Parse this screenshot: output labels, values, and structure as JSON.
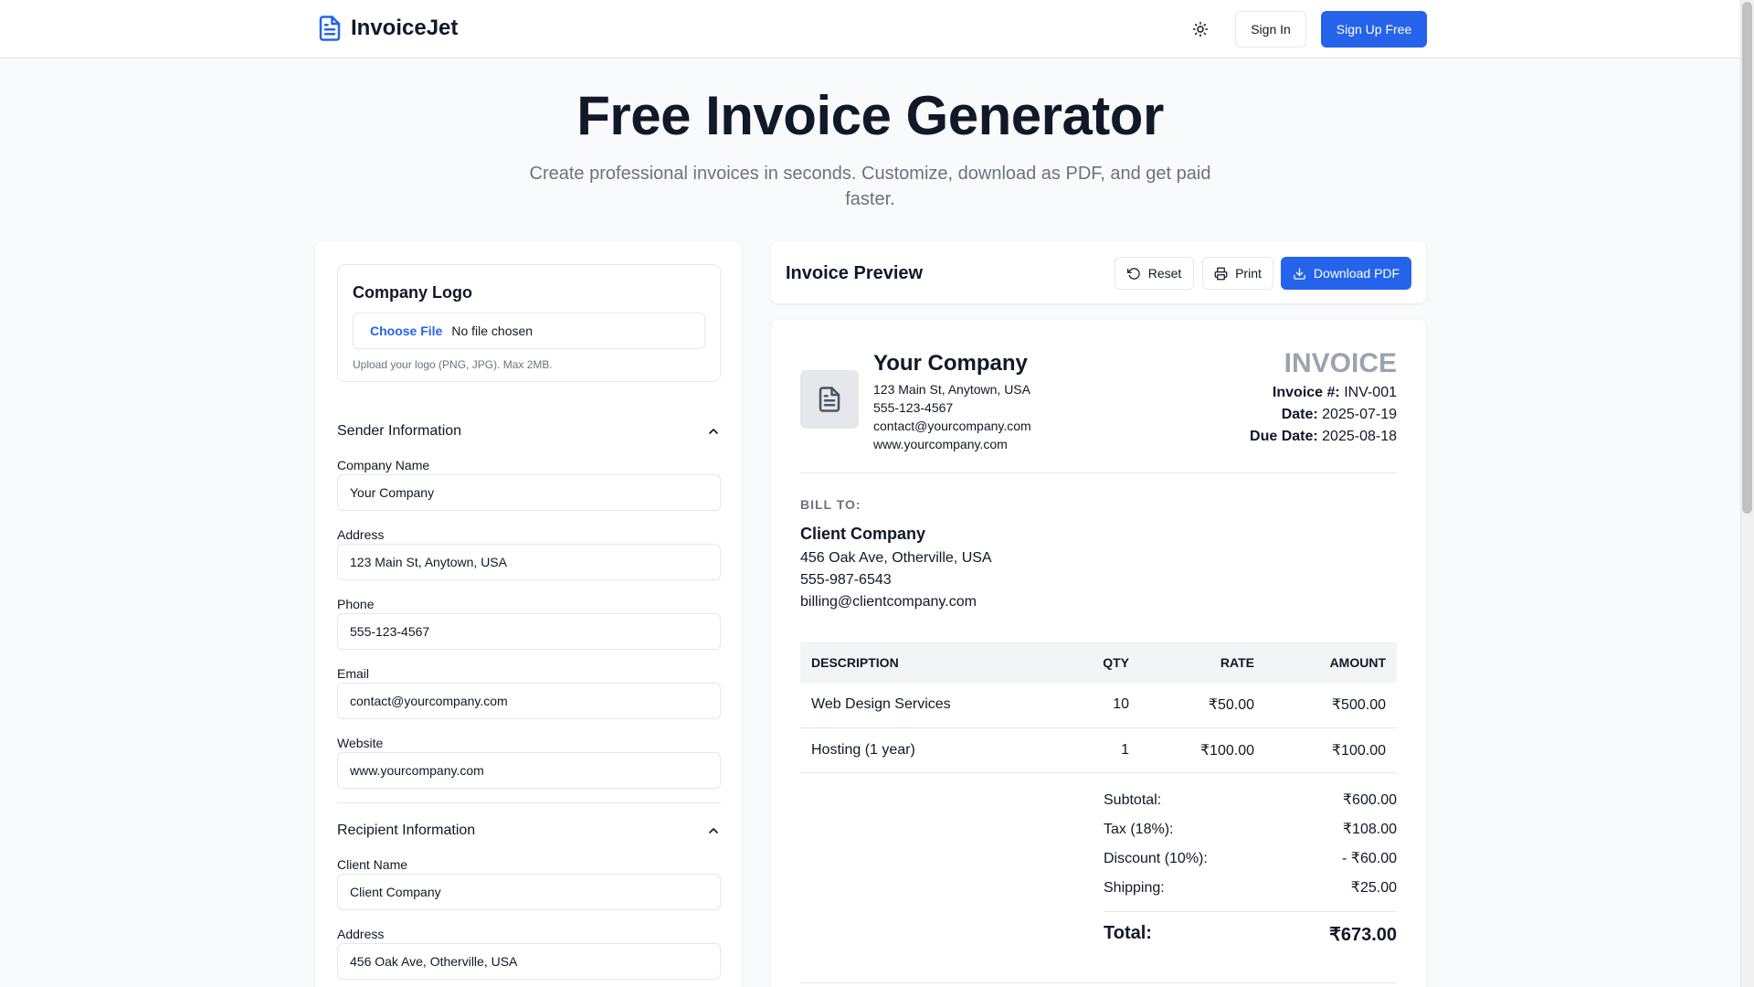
{
  "brand": {
    "name": "InvoiceJet"
  },
  "nav": {
    "signin": "Sign In",
    "signup": "Sign Up Free"
  },
  "hero": {
    "title": "Free Invoice Generator",
    "subtitle": "Create professional invoices in seconds. Customize, download as PDF, and get paid faster."
  },
  "logo_section": {
    "title": "Company Logo",
    "choose_file": "Choose File",
    "file_status": "No file chosen",
    "hint": "Upload your logo (PNG, JPG). Max 2MB."
  },
  "sender": {
    "heading": "Sender Information",
    "company_label": "Company Name",
    "company_value": "Your Company",
    "address_label": "Address",
    "address_value": "123 Main St, Anytown, USA",
    "phone_label": "Phone",
    "phone_value": "555-123-4567",
    "email_label": "Email",
    "email_value": "contact@yourcompany.com",
    "website_label": "Website",
    "website_value": "www.yourcompany.com"
  },
  "recipient": {
    "heading": "Recipient Information",
    "client_label": "Client Name",
    "client_value": "Client Company",
    "address_label": "Address",
    "address_value": "456 Oak Ave, Otherville, USA"
  },
  "preview": {
    "title": "Invoice Preview",
    "reset": "Reset",
    "print": "Print",
    "download": "Download PDF"
  },
  "invoice": {
    "company_name": "Your Company",
    "company_address": "123 Main St, Anytown, USA",
    "company_phone": "555-123-4567",
    "company_email": "contact@yourcompany.com",
    "company_website": "www.yourcompany.com",
    "word": "INVOICE",
    "number_label": "Invoice #:",
    "number": "INV-001",
    "date_label": "Date:",
    "date": "2025-07-19",
    "due_label": "Due Date:",
    "due": "2025-08-18",
    "bill_to_label": "BILL TO:",
    "client_name": "Client Company",
    "client_address": "456 Oak Ave, Otherville, USA",
    "client_phone": "555-987-6543",
    "client_email": "billing@clientcompany.com",
    "columns": {
      "desc": "Description",
      "qty": "Qty",
      "rate": "Rate",
      "amount": "Amount"
    },
    "items": [
      {
        "desc": "Web Design Services",
        "qty": "10",
        "rate": "₹50.00",
        "amount": "₹500.00"
      },
      {
        "desc": "Hosting (1 year)",
        "qty": "1",
        "rate": "₹100.00",
        "amount": "₹100.00"
      }
    ],
    "totals": {
      "subtotal_label": "Subtotal:",
      "subtotal": "₹600.00",
      "tax_label": "Tax (18%):",
      "tax": "₹108.00",
      "discount_label": "Discount (10%):",
      "discount": "- ₹60.00",
      "shipping_label": "Shipping:",
      "shipping": "₹25.00",
      "total_label": "Total:",
      "total": "₹673.00"
    }
  },
  "colors": {
    "accent": "#2563eb",
    "invoice_word": "#9ca3af",
    "muted": "#6b7280"
  },
  "icons": {
    "brand": "file-text-icon",
    "theme": "sun-icon",
    "collapse": "chevron-up-icon",
    "reset": "rotate-ccw-icon",
    "print": "printer-icon",
    "download": "download-icon",
    "logo_placeholder": "file-text-icon"
  }
}
